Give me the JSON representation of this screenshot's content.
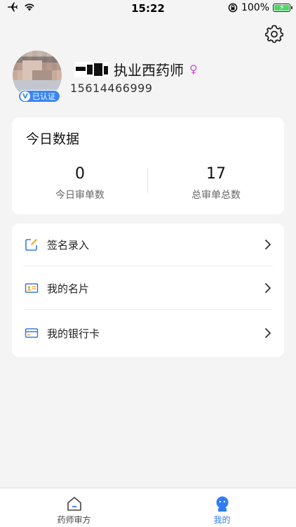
{
  "status_bar": {
    "time": "15:22",
    "battery": "100%"
  },
  "profile": {
    "title": "执业西药师",
    "gender_symbol": "♀",
    "phone": "15614466999",
    "verified_badge": "已认证",
    "verified_letter": "V"
  },
  "stats": {
    "title": "今日数据",
    "items": [
      {
        "value": "0",
        "label": "今日审单数"
      },
      {
        "value": "17",
        "label": "总审单总数"
      }
    ]
  },
  "menu": {
    "items": [
      {
        "label": "签名录入",
        "icon": "edit-icon"
      },
      {
        "label": "我的名片",
        "icon": "id-card-icon"
      },
      {
        "label": "我的银行卡",
        "icon": "bank-card-icon"
      }
    ]
  },
  "tabbar": {
    "items": [
      {
        "label": "药师审方",
        "icon": "home-icon",
        "active": false
      },
      {
        "label": "我的",
        "icon": "profile-icon",
        "active": true
      }
    ]
  },
  "colors": {
    "accent": "#2f7cf6",
    "badge": "#3b86f5",
    "gender": "#c84fd6",
    "icon_orange": "#f5a623",
    "background": "#f4f4f5"
  }
}
